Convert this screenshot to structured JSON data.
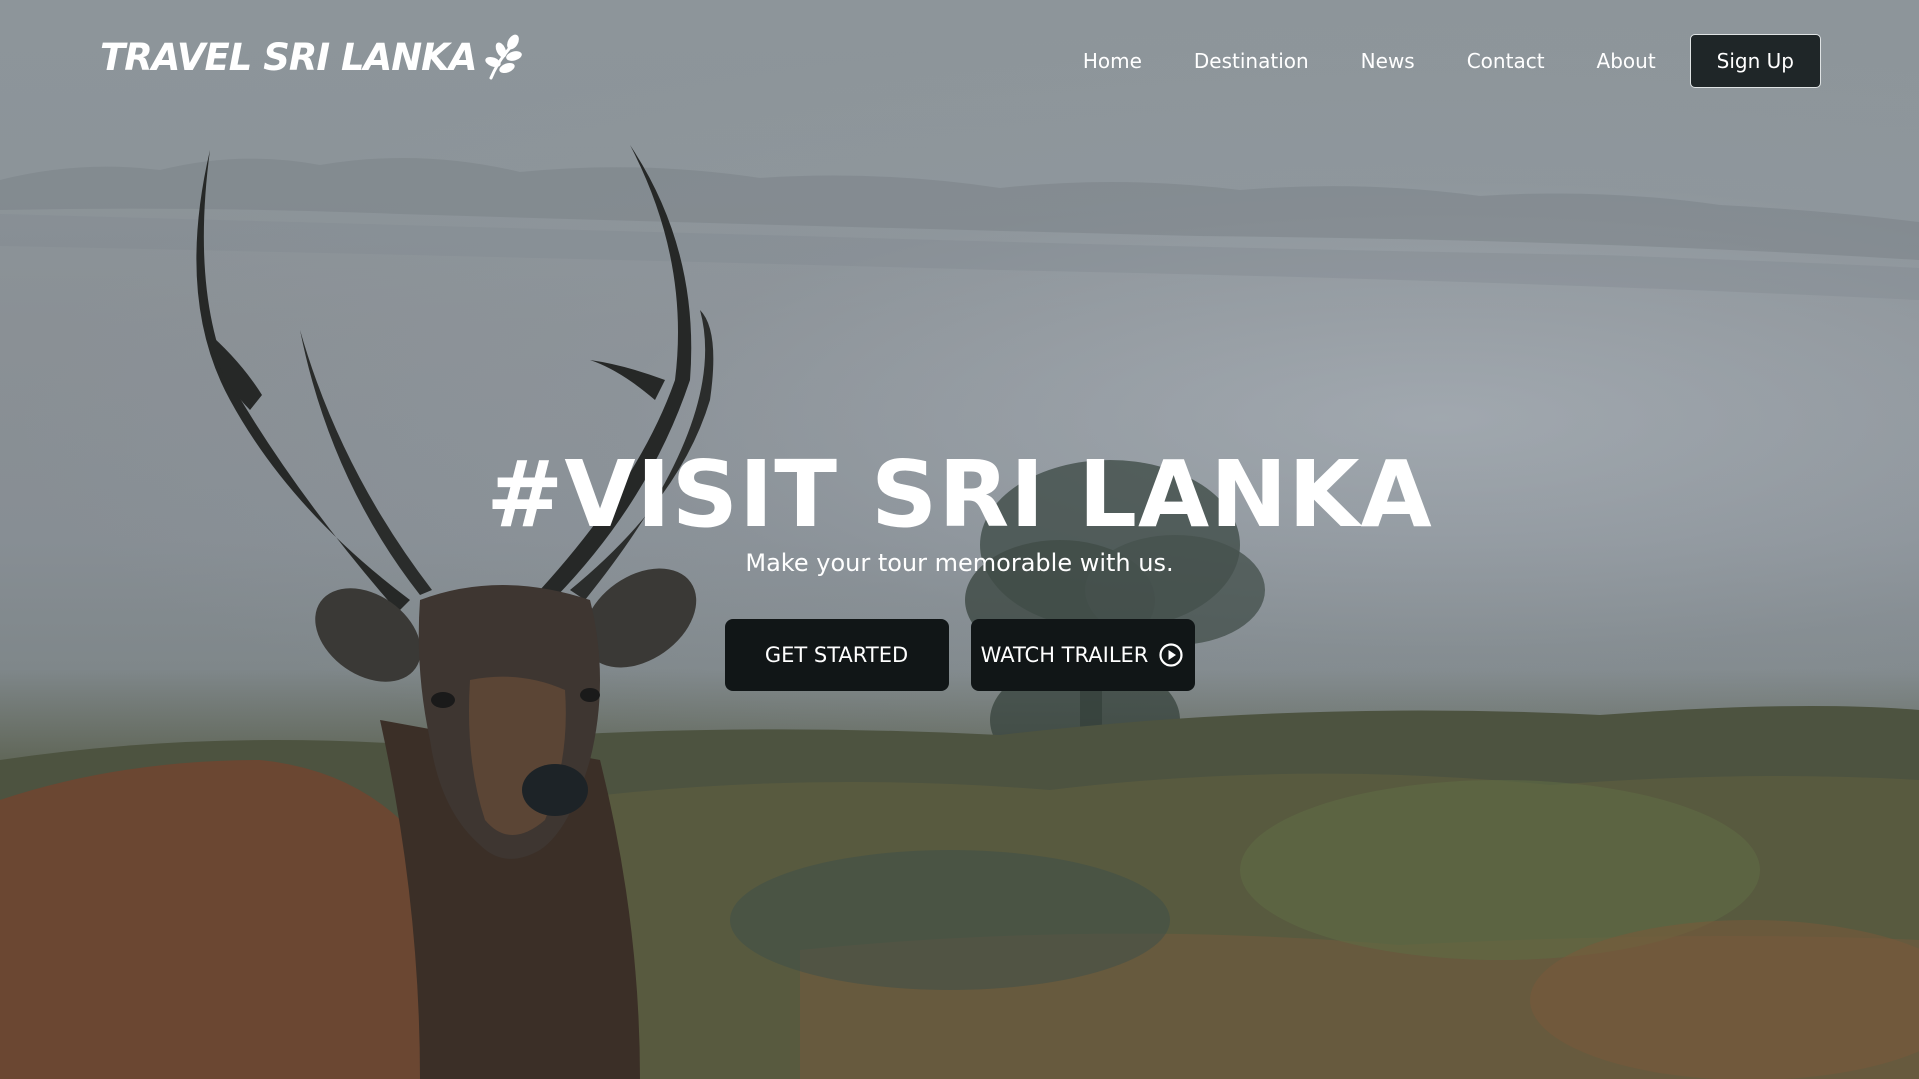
{
  "logo": {
    "text": "TRAVEL SRI LANKA",
    "icon": "leaf-sprig-icon"
  },
  "nav": {
    "links": [
      "Home",
      "Destination",
      "News",
      "Contact",
      "About"
    ],
    "signup_label": "Sign Up"
  },
  "hero": {
    "title": "#VISIT SRI LANKA",
    "subtitle": "Make your tour memorable with us.",
    "get_started_label": "GET STARTED",
    "watch_trailer_label": "WATCH TRAILER",
    "trailer_icon": "play-circle-icon",
    "background": "misty-landscape-with-deer"
  },
  "colors": {
    "button_dark": "#111617",
    "signup_bg": "#1f2628",
    "text": "#ffffff"
  }
}
